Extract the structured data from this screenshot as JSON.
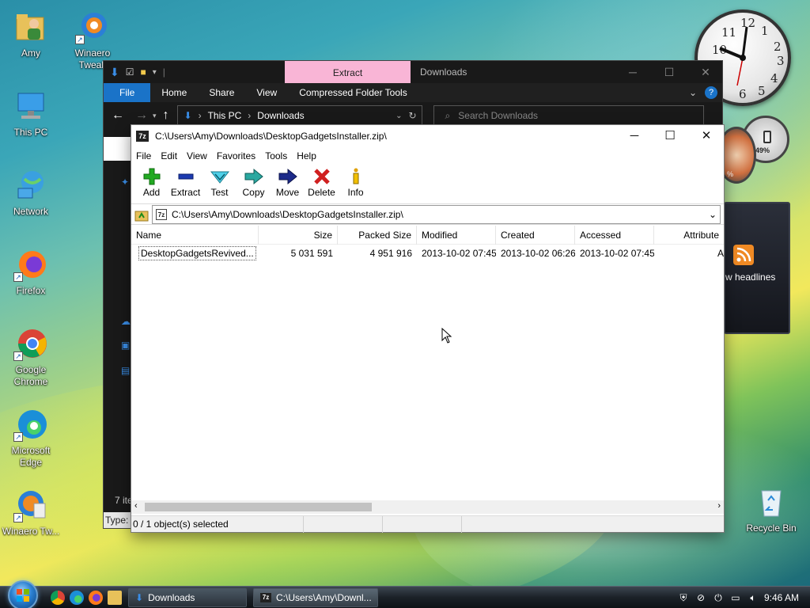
{
  "desktop": {
    "icons": [
      {
        "label": "Amy"
      },
      {
        "label": "Winaero Tweak"
      },
      {
        "label": "This PC"
      },
      {
        "label": "Network"
      },
      {
        "label": "Firefox"
      },
      {
        "label": "Google Chrome"
      },
      {
        "label": "Microsoft Edge"
      },
      {
        "label": "Winaero Tw..."
      },
      {
        "label": "Recycle Bin"
      }
    ],
    "gadgets": {
      "meter_percent": "49%",
      "meter_small": "%",
      "feed_text": "w headlines"
    }
  },
  "explorer": {
    "tab_extract": "Extract",
    "title": "Downloads",
    "ribbon": [
      "File",
      "Home",
      "Share",
      "View",
      "Compressed Folder Tools"
    ],
    "breadcrumb": [
      "This PC",
      "Downloads"
    ],
    "search_placeholder": "Search Downloads",
    "status_items": "7 ite",
    "status_type": "Type:"
  },
  "zip": {
    "title": "C:\\Users\\Amy\\Downloads\\DesktopGadgetsInstaller.zip\\",
    "menu": [
      "File",
      "Edit",
      "View",
      "Favorites",
      "Tools",
      "Help"
    ],
    "toolbar": [
      {
        "label": "Add"
      },
      {
        "label": "Extract"
      },
      {
        "label": "Test"
      },
      {
        "label": "Copy"
      },
      {
        "label": "Move"
      },
      {
        "label": "Delete"
      },
      {
        "label": "Info"
      }
    ],
    "path": "C:\\Users\\Amy\\Downloads\\DesktopGadgetsInstaller.zip\\",
    "columns": [
      "Name",
      "Size",
      "Packed Size",
      "Modified",
      "Created",
      "Accessed",
      "Attribute"
    ],
    "rows": [
      {
        "name": "DesktopGadgetsRevived...",
        "size": "5 031 591",
        "packed": "4 951 916",
        "modified": "2013-10-02 07:45",
        "created": "2013-10-02 06:26",
        "accessed": "2013-10-02 07:45",
        "attr": "A"
      }
    ],
    "status": "0 / 1 object(s) selected"
  },
  "taskbar": {
    "buttons": [
      {
        "label": "Downloads"
      },
      {
        "label": "C:\\Users\\Amy\\Downl..."
      }
    ],
    "clock": "9:46 AM"
  },
  "colors": {
    "explorer_extract_tab": "#f9b5d6",
    "ribbon_file": "#1a73c8",
    "add_green": "#22aa22",
    "delete_red": "#d02020",
    "move_navy": "#1c2a8a"
  }
}
